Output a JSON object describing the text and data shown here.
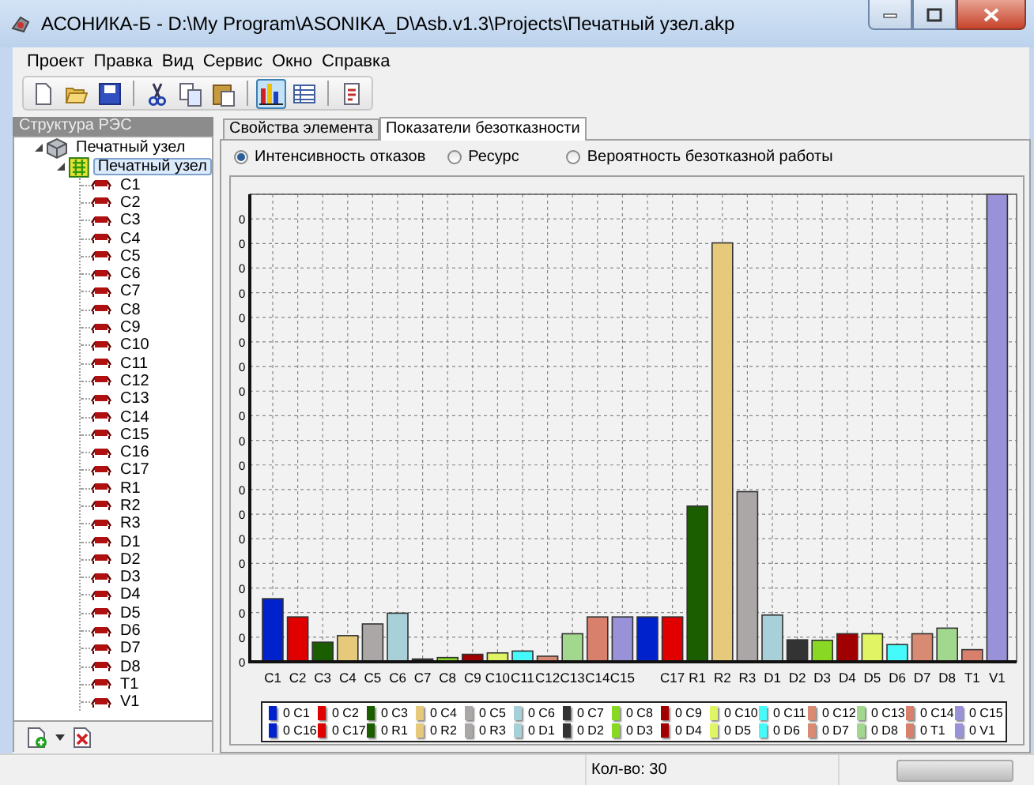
{
  "window": {
    "title": "АСОНИКА-Б - D:\\My Program\\ASONIKA_D\\Asb.v1.3\\Projects\\Печатный узел.akp"
  },
  "menu": [
    "Проект",
    "Правка",
    "Вид",
    "Сервис",
    "Окно",
    "Справка"
  ],
  "toolbar": [
    {
      "kind": "new",
      "pressed": false
    },
    {
      "kind": "open",
      "pressed": false
    },
    {
      "kind": "save",
      "pressed": false
    },
    {
      "kind": "separator"
    },
    {
      "kind": "cut",
      "pressed": false
    },
    {
      "kind": "copy",
      "pressed": false
    },
    {
      "kind": "paste",
      "pressed": false
    },
    {
      "kind": "separator"
    },
    {
      "kind": "chart",
      "pressed": true
    },
    {
      "kind": "table",
      "pressed": false
    },
    {
      "kind": "separator"
    },
    {
      "kind": "report",
      "pressed": false
    }
  ],
  "sidebar": {
    "title": "Структура РЭС",
    "tree": [
      {
        "label": "Печатный узел",
        "kind": "assembly",
        "expanded": true,
        "selected": false,
        "children": [
          {
            "label": "Печатный узел",
            "kind": "board",
            "expanded": true,
            "selected": true,
            "children": [
              {
                "label": "C1",
                "kind": "component",
                "selected": false
              },
              {
                "label": "C2",
                "kind": "component",
                "selected": false
              },
              {
                "label": "C3",
                "kind": "component",
                "selected": false
              },
              {
                "label": "C4",
                "kind": "component",
                "selected": false
              },
              {
                "label": "C5",
                "kind": "component",
                "selected": false
              },
              {
                "label": "C6",
                "kind": "component",
                "selected": false
              },
              {
                "label": "C7",
                "kind": "component",
                "selected": false
              },
              {
                "label": "C8",
                "kind": "component",
                "selected": false
              },
              {
                "label": "C9",
                "kind": "component",
                "selected": false
              },
              {
                "label": "C10",
                "kind": "component",
                "selected": false
              },
              {
                "label": "C11",
                "kind": "component",
                "selected": false
              },
              {
                "label": "C12",
                "kind": "component",
                "selected": false
              },
              {
                "label": "C13",
                "kind": "component",
                "selected": false
              },
              {
                "label": "C14",
                "kind": "component",
                "selected": false
              },
              {
                "label": "C15",
                "kind": "component",
                "selected": false
              },
              {
                "label": "C16",
                "kind": "component",
                "selected": false
              },
              {
                "label": "C17",
                "kind": "component",
                "selected": false
              },
              {
                "label": "R1",
                "kind": "component",
                "selected": false
              },
              {
                "label": "R2",
                "kind": "component",
                "selected": false
              },
              {
                "label": "R3",
                "kind": "component",
                "selected": false
              },
              {
                "label": "D1",
                "kind": "component",
                "selected": false
              },
              {
                "label": "D2",
                "kind": "component",
                "selected": false
              },
              {
                "label": "D3",
                "kind": "component",
                "selected": false
              },
              {
                "label": "D4",
                "kind": "component",
                "selected": false
              },
              {
                "label": "D5",
                "kind": "component",
                "selected": false
              },
              {
                "label": "D6",
                "kind": "component",
                "selected": false
              },
              {
                "label": "D7",
                "kind": "component",
                "selected": false
              },
              {
                "label": "D8",
                "kind": "component",
                "selected": false
              },
              {
                "label": "T1",
                "kind": "component",
                "selected": false
              },
              {
                "label": "V1",
                "kind": "component",
                "selected": false
              }
            ]
          }
        ]
      }
    ],
    "bottom_buttons": [
      {
        "kind": "add_menu"
      },
      {
        "kind": "delete"
      }
    ]
  },
  "tabs": [
    {
      "label": "Свойства элемента",
      "selected": false
    },
    {
      "label": "Показатели безотказности",
      "selected": true
    }
  ],
  "radios": [
    {
      "label": "Интенсивность отказов",
      "selected": true
    },
    {
      "label": "Ресурс",
      "selected": false
    },
    {
      "label": "Вероятность безотказной работы",
      "selected": false
    }
  ],
  "chart": {
    "y_tick_labels": [
      "0",
      "0",
      "0",
      "0",
      "0",
      "0",
      "0",
      "0",
      "0",
      "0",
      "0",
      "0",
      "0",
      "0",
      "0",
      "0",
      "0",
      "0",
      "0"
    ],
    "bars": [
      {
        "label": "C1",
        "color": "#0022cc"
      },
      {
        "label": "C2",
        "color": "#e00000"
      },
      {
        "label": "C3",
        "color": "#1b5e00"
      },
      {
        "label": "C4",
        "color": "#e6c97a"
      },
      {
        "label": "C5",
        "color": "#aba7a7"
      },
      {
        "label": "C6",
        "color": "#a8d0d8"
      },
      {
        "label": "C7",
        "color": "#333333"
      },
      {
        "label": "C8",
        "color": "#88d824"
      },
      {
        "label": "C9",
        "color": "#a00000"
      },
      {
        "label": "C10",
        "color": "#e0f464"
      },
      {
        "label": "C11",
        "color": "#44fafa"
      },
      {
        "label": "C12",
        "color": "#d88a72"
      },
      {
        "label": "C13",
        "color": "#a2d88e"
      },
      {
        "label": "C14",
        "color": "#d8806c"
      },
      {
        "label": "C15",
        "color": "#9a92d8"
      },
      {
        "color": "#0022cc"
      },
      {
        "label": "C17",
        "color": "#e00000"
      },
      {
        "label": "R1",
        "color": "#1b5e00"
      },
      {
        "label": "R2",
        "color": "#e6c97a"
      },
      {
        "label": "R3",
        "color": "#aba7a7"
      },
      {
        "label": "D1",
        "color": "#a8d0d8"
      },
      {
        "label": "D2",
        "color": "#333333"
      },
      {
        "label": "D3",
        "color": "#88d824"
      },
      {
        "label": "D4",
        "color": "#a00000"
      },
      {
        "label": "D5",
        "color": "#e0f464"
      },
      {
        "label": "D6",
        "color": "#44fafa"
      },
      {
        "label": "D7",
        "color": "#d88a72"
      },
      {
        "label": "D8",
        "color": "#a2d88e"
      },
      {
        "label": "T1",
        "color": "#d8806c"
      },
      {
        "label": "V1",
        "color": "#9a92d8"
      }
    ],
    "legend": [
      {
        "text": "0 C1",
        "color": "#0022cc"
      },
      {
        "text": "0 C2",
        "color": "#e00000"
      },
      {
        "text": "0 C3",
        "color": "#1b5e00"
      },
      {
        "text": "0 C4",
        "color": "#e6c97a"
      },
      {
        "text": "0 C5",
        "color": "#aba7a7"
      },
      {
        "text": "0 C6",
        "color": "#a8d0d8"
      },
      {
        "text": "0 C7",
        "color": "#333333"
      },
      {
        "text": "0 C8",
        "color": "#88d824"
      },
      {
        "text": "0 C9",
        "color": "#a00000"
      },
      {
        "text": "0 C10",
        "color": "#e0f464"
      },
      {
        "text": "0 C11",
        "color": "#44fafa"
      },
      {
        "text": "0 C12",
        "color": "#d88a72"
      },
      {
        "text": "0 C13",
        "color": "#a2d88e"
      },
      {
        "text": "0 C14",
        "color": "#d8806c"
      },
      {
        "text": "0 C15",
        "color": "#9a92d8"
      },
      {
        "text": "0 C16",
        "color": "#0022cc"
      },
      {
        "text": "0 C17",
        "color": "#e00000"
      },
      {
        "text": "0 R1",
        "color": "#1b5e00"
      },
      {
        "text": "0 R2",
        "color": "#e6c97a"
      },
      {
        "text": "0 R3",
        "color": "#aba7a7"
      },
      {
        "text": "0 D1",
        "color": "#a8d0d8"
      },
      {
        "text": "0 D2",
        "color": "#333333"
      },
      {
        "text": "0 D3",
        "color": "#88d824"
      },
      {
        "text": "0 D4",
        "color": "#a00000"
      },
      {
        "text": "0 D5",
        "color": "#e0f464"
      },
      {
        "text": "0 D6",
        "color": "#44fafa"
      },
      {
        "text": "0 D7",
        "color": "#d88a72"
      },
      {
        "text": "0 D8",
        "color": "#a2d88e"
      },
      {
        "text": "0 T1",
        "color": "#d8806c"
      },
      {
        "text": "0 V1",
        "color": "#9a92d8"
      }
    ]
  },
  "status_bar": {
    "count": "Кол-во: 30"
  }
}
